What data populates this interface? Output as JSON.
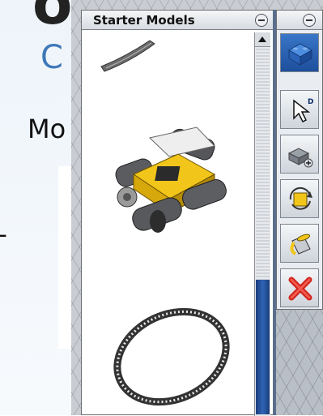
{
  "background_slide": {
    "heading_partial": "ole",
    "subheading_partial": "C",
    "bullet_partial": "Mo",
    "dash": "-"
  },
  "starter_models": {
    "title": "Starter Models",
    "items": [
      {
        "name": "cropped-model"
      },
      {
        "name": "tracked-vehicle"
      },
      {
        "name": "train-track-loop"
      }
    ]
  },
  "tools": {
    "items": [
      {
        "icon": "blue-brick-icon"
      },
      {
        "icon": "select-arrow-icon"
      },
      {
        "icon": "add-brick-icon"
      },
      {
        "icon": "rotate-icon"
      },
      {
        "icon": "paint-bucket-icon"
      },
      {
        "icon": "delete-icon"
      }
    ]
  },
  "colors": {
    "accent_blue": "#2f64b6",
    "title_bar": "#d7dbe1",
    "delete_red": "#d0231c",
    "brick_yellow": "#f2c51a"
  }
}
